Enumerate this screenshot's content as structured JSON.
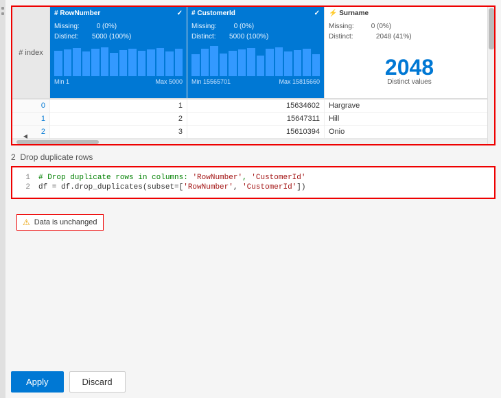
{
  "table": {
    "index_header": "# index",
    "columns": [
      {
        "id": "RowNumber",
        "label": "RowNumber",
        "type": "numeric",
        "missing": "0 (0%)",
        "distinct": "5000 (100%)",
        "min": "Min 1",
        "max": "Max 5000",
        "bars": [
          80,
          85,
          90,
          78,
          88,
          92,
          75,
          82,
          87,
          80,
          85,
          90,
          78,
          88
        ]
      },
      {
        "id": "CustomerId",
        "label": "CustomerId",
        "type": "numeric",
        "missing": "0 (0%)",
        "distinct": "5000 (100%)",
        "min": "Min 15565701",
        "max": "Max 15815660",
        "bars": [
          70,
          88,
          95,
          72,
          80,
          85,
          90,
          65,
          88,
          92,
          78,
          82,
          86,
          70
        ]
      },
      {
        "id": "Surname",
        "label": "Surname",
        "type": "text",
        "missing": "0 (0%)",
        "distinct": "2048 (41%)",
        "distinct_count": "2048",
        "distinct_label": "Distinct values"
      }
    ],
    "rows": [
      {
        "index": "0",
        "row_number": "1",
        "customer_id": "15634602",
        "surname": "Hargrave"
      },
      {
        "index": "1",
        "row_number": "2",
        "customer_id": "15647311",
        "surname": "Hill"
      },
      {
        "index": "2",
        "row_number": "3",
        "customer_id": "15610394",
        "surname": "Onio"
      }
    ]
  },
  "step": {
    "number": "2",
    "label": "Drop duplicate rows",
    "code": [
      {
        "line": "1",
        "content": "# Drop duplicate rows in columns: 'RowNumber', 'CustomerId'"
      },
      {
        "line": "2",
        "content": "df = df.drop_duplicates(subset=['RowNumber', 'CustomerId'])"
      }
    ]
  },
  "status": {
    "icon": "⚠",
    "text": "Data is unchanged"
  },
  "actions": {
    "apply": "Apply",
    "discard": "Discard"
  }
}
